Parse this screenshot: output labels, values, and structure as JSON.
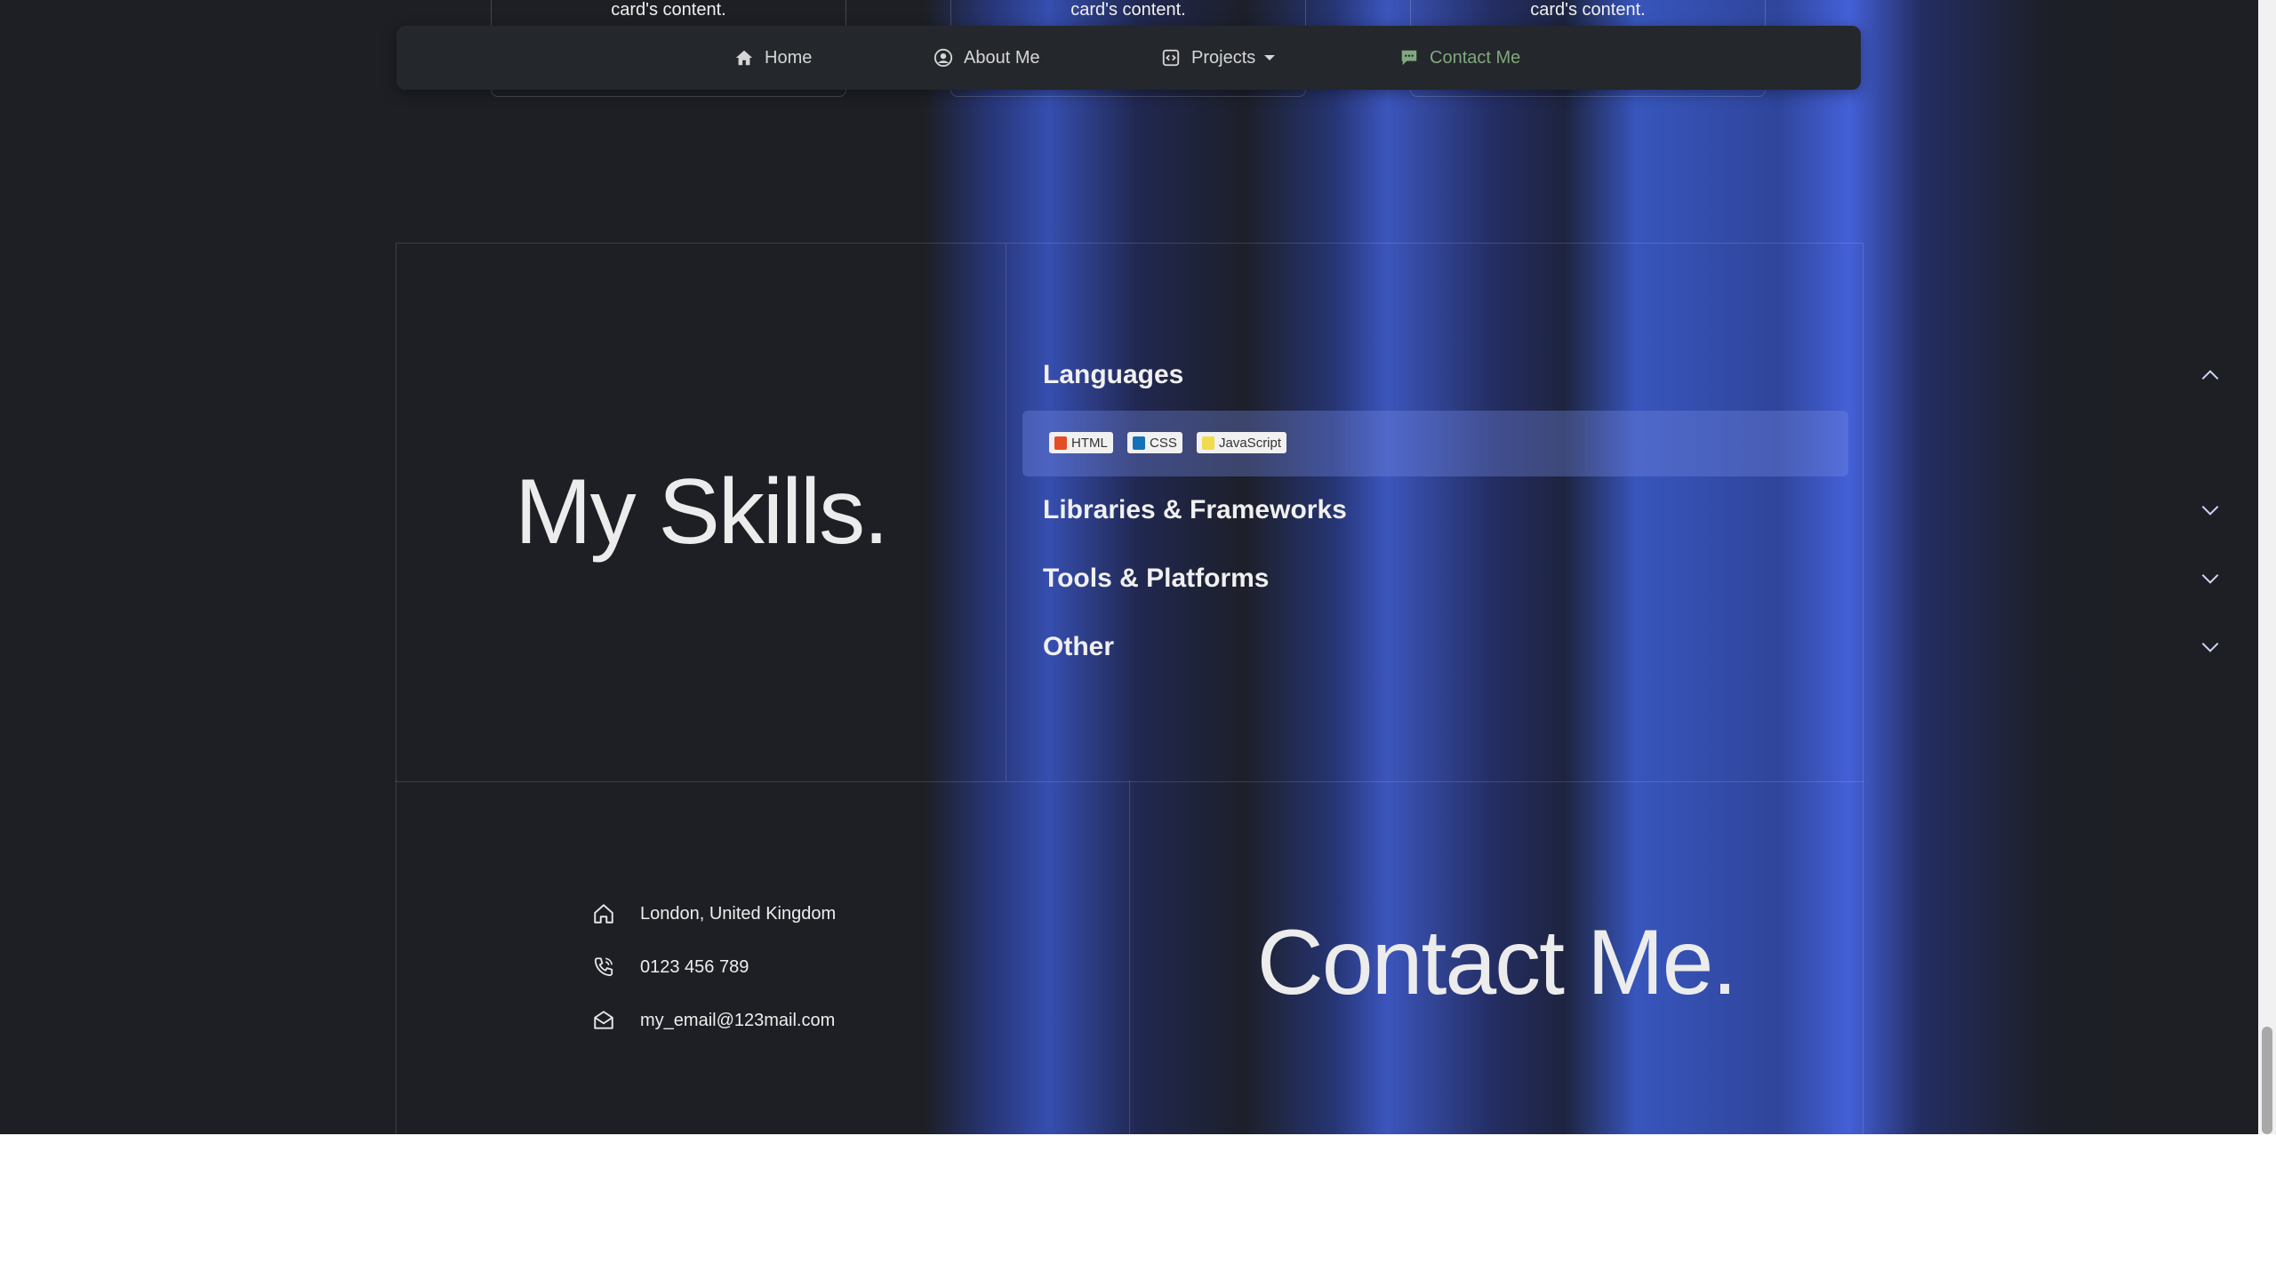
{
  "cards": [
    {
      "text": "card's content."
    },
    {
      "text": "card's content."
    },
    {
      "text": "card's content."
    }
  ],
  "navbar": {
    "items": [
      {
        "label": "Home",
        "icon": "house-icon"
      },
      {
        "label": "About Me",
        "icon": "user-circle-icon"
      },
      {
        "label": "Projects",
        "icon": "code-icon",
        "dropdown": true
      },
      {
        "label": "Contact Me",
        "icon": "chat-icon",
        "active": true
      }
    ],
    "active_color": "#7fa97e"
  },
  "skills": {
    "title": "My Skills.",
    "categories": [
      {
        "label": "Languages",
        "expanded": true,
        "items": [
          {
            "label": "HTML",
            "icon": "html5-icon"
          },
          {
            "label": "CSS",
            "icon": "css3-icon"
          },
          {
            "label": "JavaScript",
            "icon": "javascript-icon"
          }
        ]
      },
      {
        "label": "Libraries & Frameworks",
        "expanded": false
      },
      {
        "label": "Tools & Platforms",
        "expanded": false
      },
      {
        "label": "Other",
        "expanded": false
      }
    ]
  },
  "contact": {
    "title": "Contact Me.",
    "address": "London, United Kingdom",
    "phone": "0123 456 789",
    "email": "my_email@123mail.com"
  },
  "colors": {
    "background": "#1d1f24",
    "accent_blue": "#3d5fd6",
    "navbar_bg": "#24272c"
  }
}
